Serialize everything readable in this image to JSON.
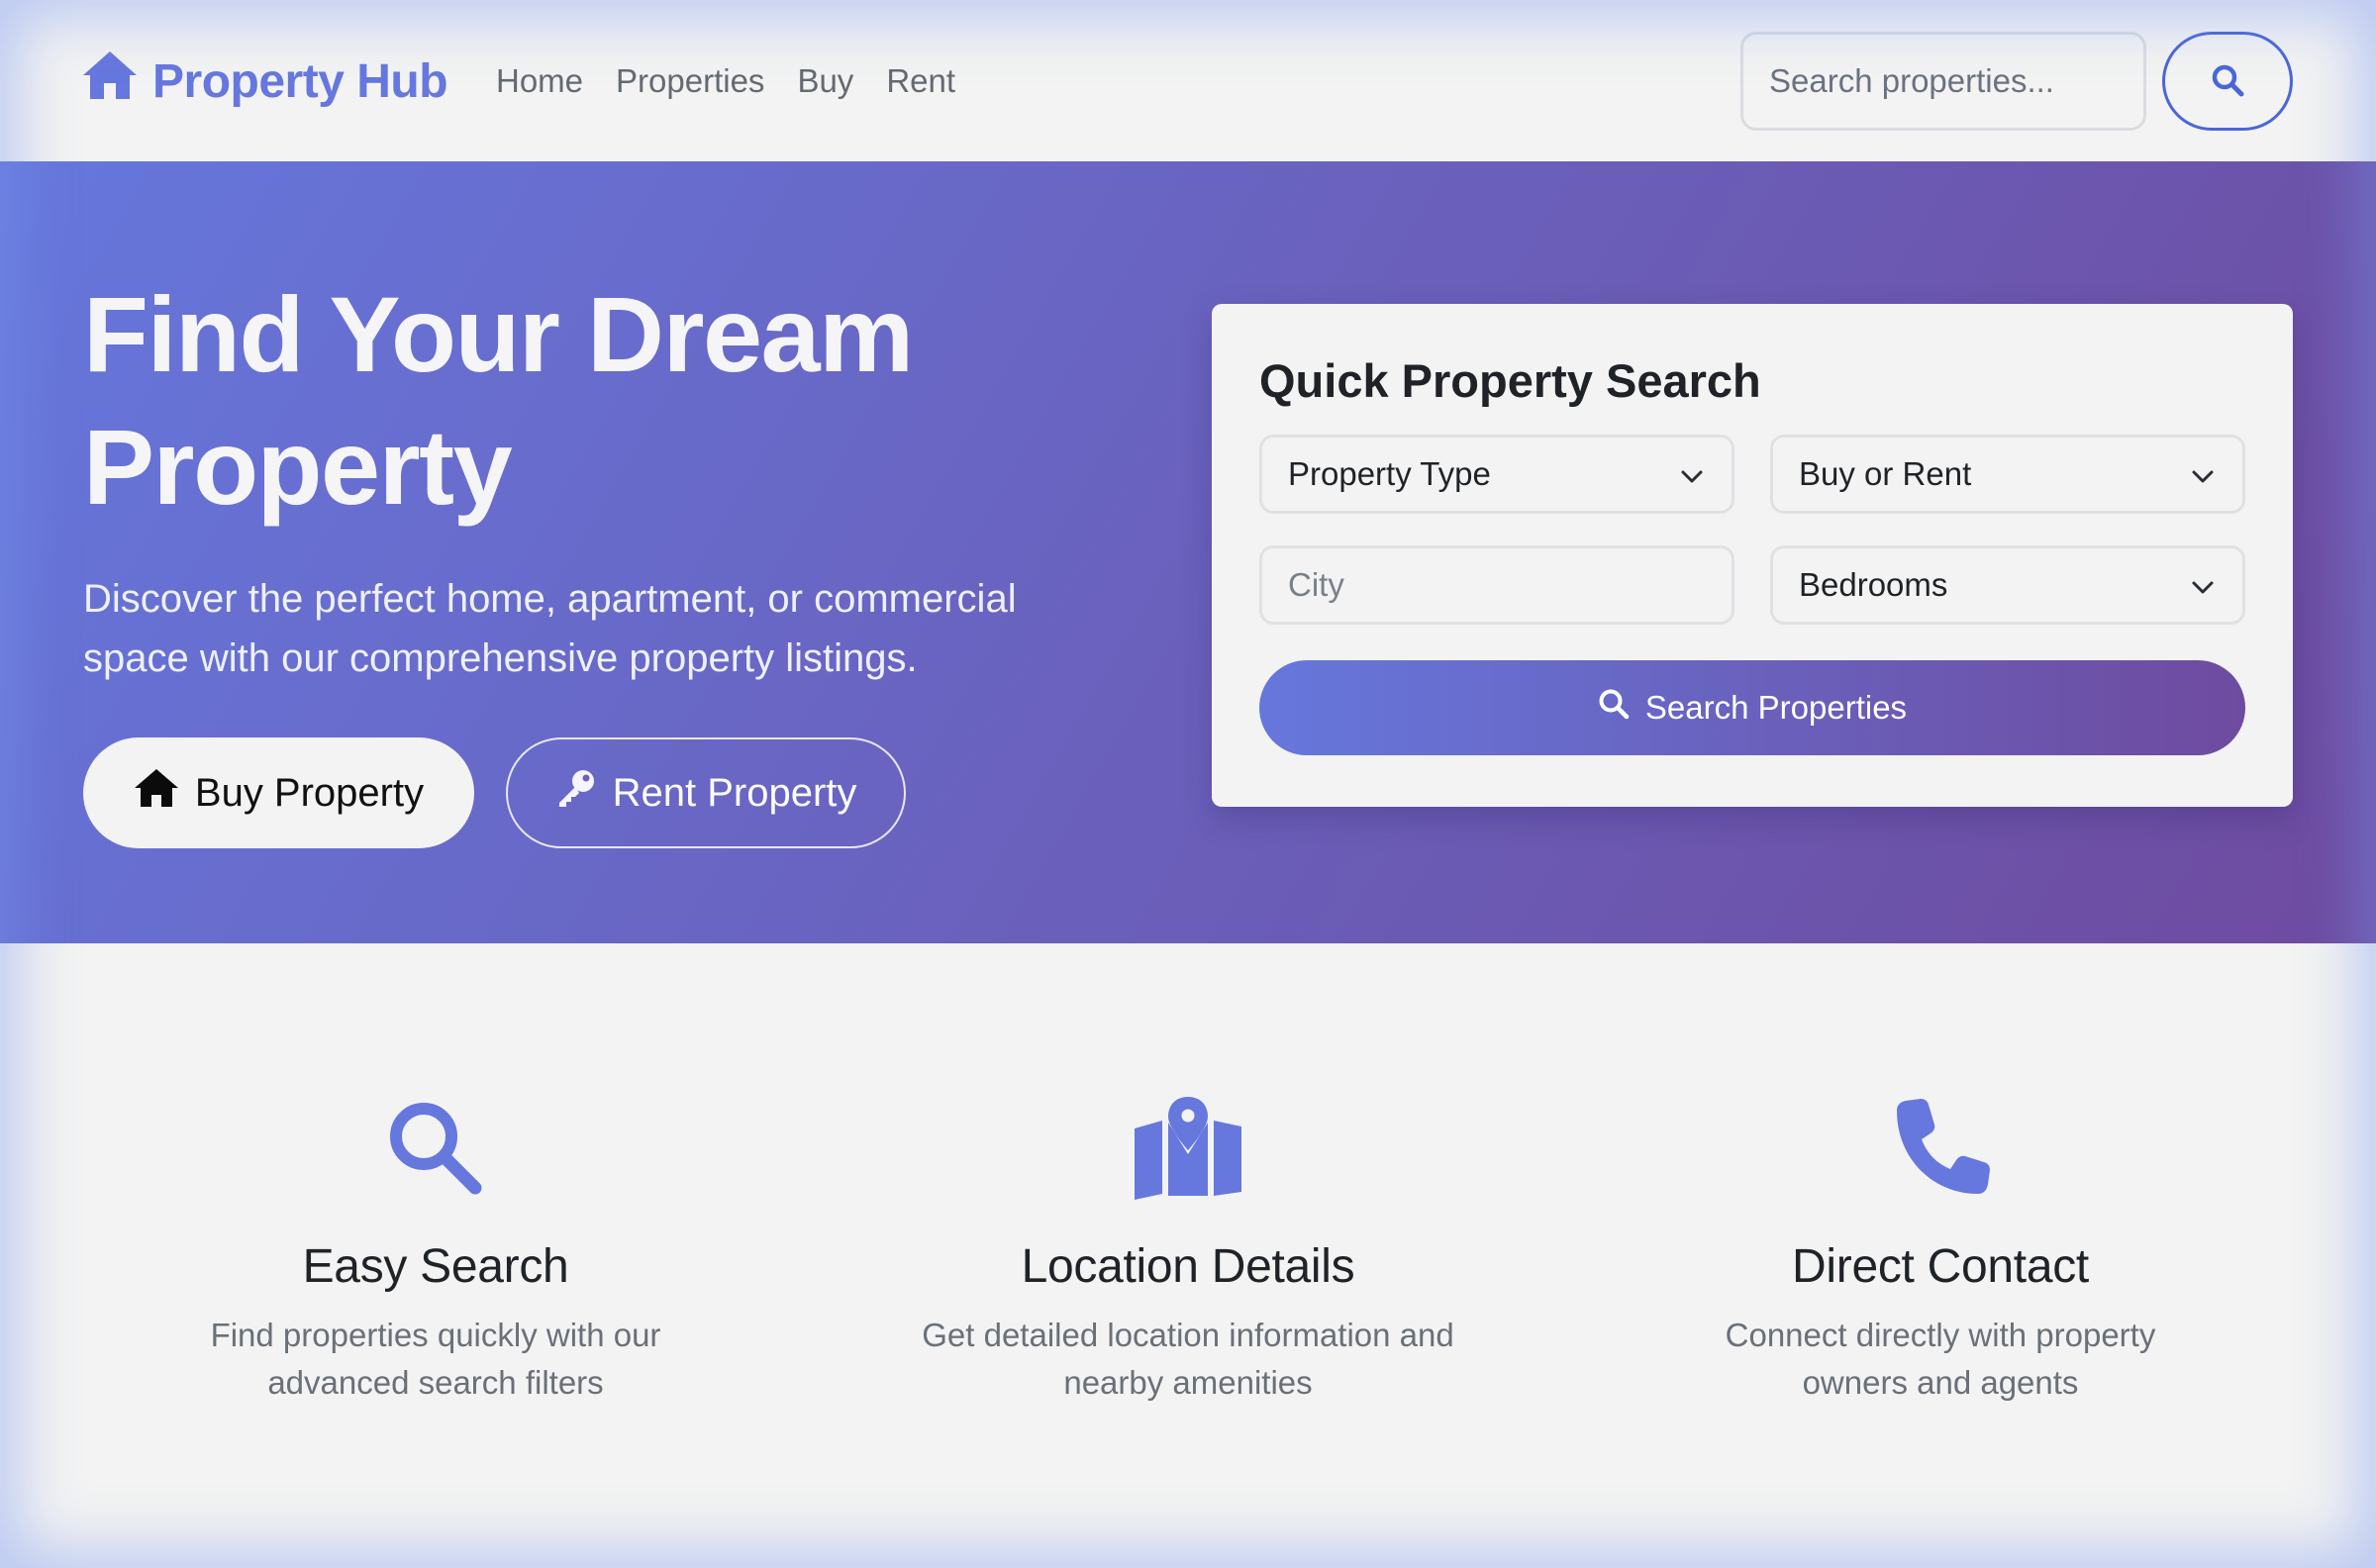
{
  "colors": {
    "accent": "#6677dd",
    "nav_button_border": "#4a66d8",
    "hero_gradient_start": "#6677dc",
    "hero_gradient_end": "#6e4b9f",
    "page_background": "#f3f3f3"
  },
  "navbar": {
    "brand": {
      "icon": "house-icon",
      "label": "Property Hub"
    },
    "links": [
      "Home",
      "Properties",
      "Buy",
      "Rent"
    ],
    "search": {
      "placeholder": "Search properties...",
      "value": "",
      "button_icon": "search-icon"
    }
  },
  "hero": {
    "title": "Find Your Dream Property",
    "subtitle": "Discover the perfect home, apartment, or commercial space with our comprehensive property listings.",
    "buttons": {
      "buy": {
        "icon": "house-icon",
        "label": "Buy Property"
      },
      "rent": {
        "icon": "key-icon",
        "label": "Rent Property"
      }
    }
  },
  "quick_search": {
    "title": "Quick Property Search",
    "property_type": {
      "selected": "Property Type",
      "icon": "chevron-down-icon"
    },
    "buy_or_rent": {
      "selected": "Buy or Rent",
      "icon": "chevron-down-icon"
    },
    "city": {
      "placeholder": "City",
      "value": ""
    },
    "bedrooms": {
      "selected": "Bedrooms",
      "icon": "chevron-down-icon"
    },
    "submit": {
      "icon": "search-icon",
      "label": "Search Properties"
    }
  },
  "features": [
    {
      "icon": "magnifier-icon",
      "title": "Easy Search",
      "description": "Find properties quickly with our advanced search filters"
    },
    {
      "icon": "map-pin-icon",
      "title": "Location Details",
      "description": "Get detailed location information and nearby amenities"
    },
    {
      "icon": "phone-icon",
      "title": "Direct Contact",
      "description": "Connect directly with property owners and agents"
    }
  ]
}
